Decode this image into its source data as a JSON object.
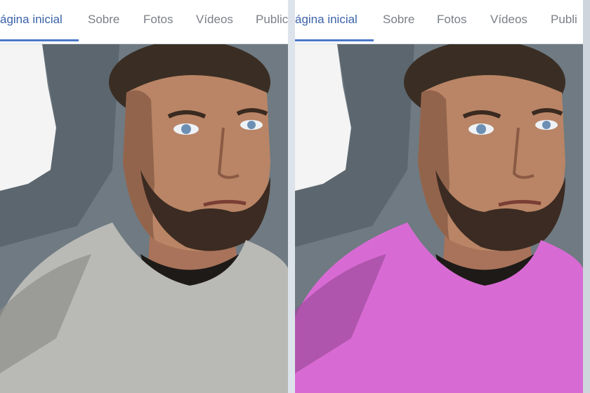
{
  "left": {
    "tabs": [
      {
        "label": "ágina inicial"
      },
      {
        "label": "Sobre"
      },
      {
        "label": "Fotos"
      },
      {
        "label": "Vídeos"
      },
      {
        "label": "Public"
      }
    ],
    "shirt_color": "#b9b9b5"
  },
  "right": {
    "tabs": [
      {
        "label": "ágina inicial"
      },
      {
        "label": "Sobre"
      },
      {
        "label": "Fotos"
      },
      {
        "label": "Vídeos"
      },
      {
        "label": "Publi"
      }
    ],
    "shirt_color": "#d86bd3"
  },
  "colors": {
    "active_tab": "#3b63a8",
    "inactive_tab": "#7a7f86",
    "underline": "#4a78c8"
  }
}
